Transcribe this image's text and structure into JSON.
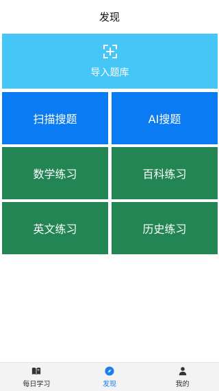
{
  "header": {
    "title": "发现"
  },
  "import_tile": {
    "label": "导入题库",
    "icon": "scan-add-icon",
    "color": "#45c6f7"
  },
  "tiles": [
    {
      "label": "扫描搜题",
      "color": "#0a7bf2"
    },
    {
      "label": "AI搜题",
      "color": "#0a7bf2"
    },
    {
      "label": "数学练习",
      "color": "#228553"
    },
    {
      "label": "百科练习",
      "color": "#228553"
    },
    {
      "label": "英文练习",
      "color": "#228553"
    },
    {
      "label": "历史练习",
      "color": "#228553"
    }
  ],
  "tabbar": {
    "items": [
      {
        "label": "每日学习",
        "icon": "book-icon",
        "active": false
      },
      {
        "label": "发现",
        "icon": "compass-icon",
        "active": true
      },
      {
        "label": "我的",
        "icon": "person-icon",
        "active": false
      }
    ],
    "active_color": "#1a7df3"
  }
}
